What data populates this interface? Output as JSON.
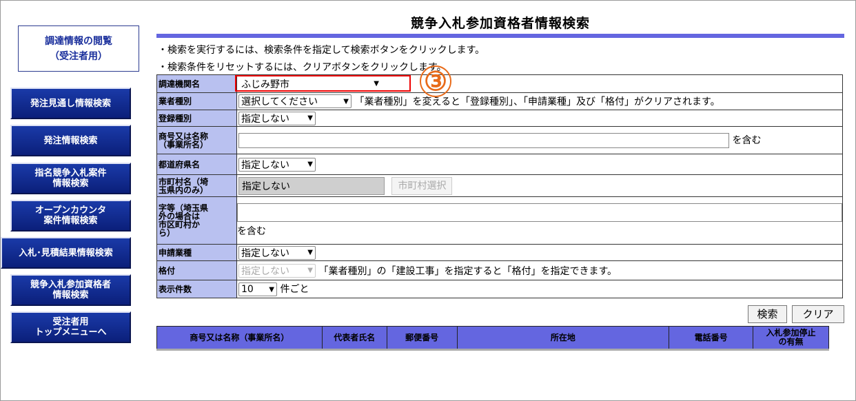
{
  "sidebar": {
    "brand_line1": "調達情報の閲覧",
    "brand_line2": "（受注者用）",
    "items": [
      {
        "line1": "発注見通し情報検索",
        "line2": ""
      },
      {
        "line1": "発注情報検索",
        "line2": ""
      },
      {
        "line1": "指名競争入札案件",
        "line2": "情報検索"
      },
      {
        "line1": "オープンカウンタ",
        "line2": "案件情報検索"
      },
      {
        "line1": "入札･見積結果情報検索",
        "line2": ""
      },
      {
        "line1": "競争入札参加資格者",
        "line2": "情報検索"
      },
      {
        "line1": "受注者用",
        "line2": "トップメニューへ"
      }
    ]
  },
  "page": {
    "title": "競争入札参加資格者情報検索",
    "note1": "・検索を実行するには、検索条件を指定して検索ボタンをクリックします。",
    "note2": "・検索条件をリセットするには、クリアボタンをクリックします。"
  },
  "form": {
    "agency": {
      "label": "調達機関名",
      "value": "ふじみ野市"
    },
    "business_type": {
      "label": "業者種別",
      "value": "選択してください",
      "hint": "「業者種別」を変えると「登録種別」、「申請業種」及び「格付」がクリアされます。"
    },
    "registration_type": {
      "label": "登録種別",
      "value": "指定しない"
    },
    "company_name": {
      "label_line1": "商号又は名称",
      "label_line2": "（事業所名）",
      "value": "",
      "suffix": "を含む"
    },
    "prefecture": {
      "label": "都道府県名",
      "value": "指定しない"
    },
    "municipality": {
      "label_line1": "市町村名（埼",
      "label_line2": "玉県内のみ）",
      "value": "指定しない",
      "button": "市町村選択"
    },
    "district": {
      "label_line1": "字等（埼玉県",
      "label_line2": "外の場合は",
      "label_line3": "市区町村か",
      "label_line4": "ら）",
      "value": "",
      "suffix": "を含む"
    },
    "application_industry": {
      "label": "申請業種",
      "value": "指定しない"
    },
    "rating": {
      "label": "格付",
      "value": "指定しない",
      "hint": "「業者種別」の「建設工事」を指定すると「格付」を指定できます。"
    },
    "display_count": {
      "label": "表示件数",
      "value": "10",
      "suffix": "件ごと"
    }
  },
  "annotation": {
    "step_number": "③"
  },
  "actions": {
    "search": "検索",
    "clear": "クリア"
  },
  "results": {
    "columns": [
      "商号又は名称（事業所名）",
      "代表者氏名",
      "郵便番号",
      "所在地",
      "電話番号"
    ],
    "last_col_line1": "入札参加停止",
    "last_col_line2": "の有無"
  },
  "colors": {
    "nav_button": "#0b1f7a",
    "label_cell": "#b9c1f0",
    "accent_rule": "#6466e0",
    "highlight": "#e00000",
    "step_badge": "#e86b1a"
  }
}
